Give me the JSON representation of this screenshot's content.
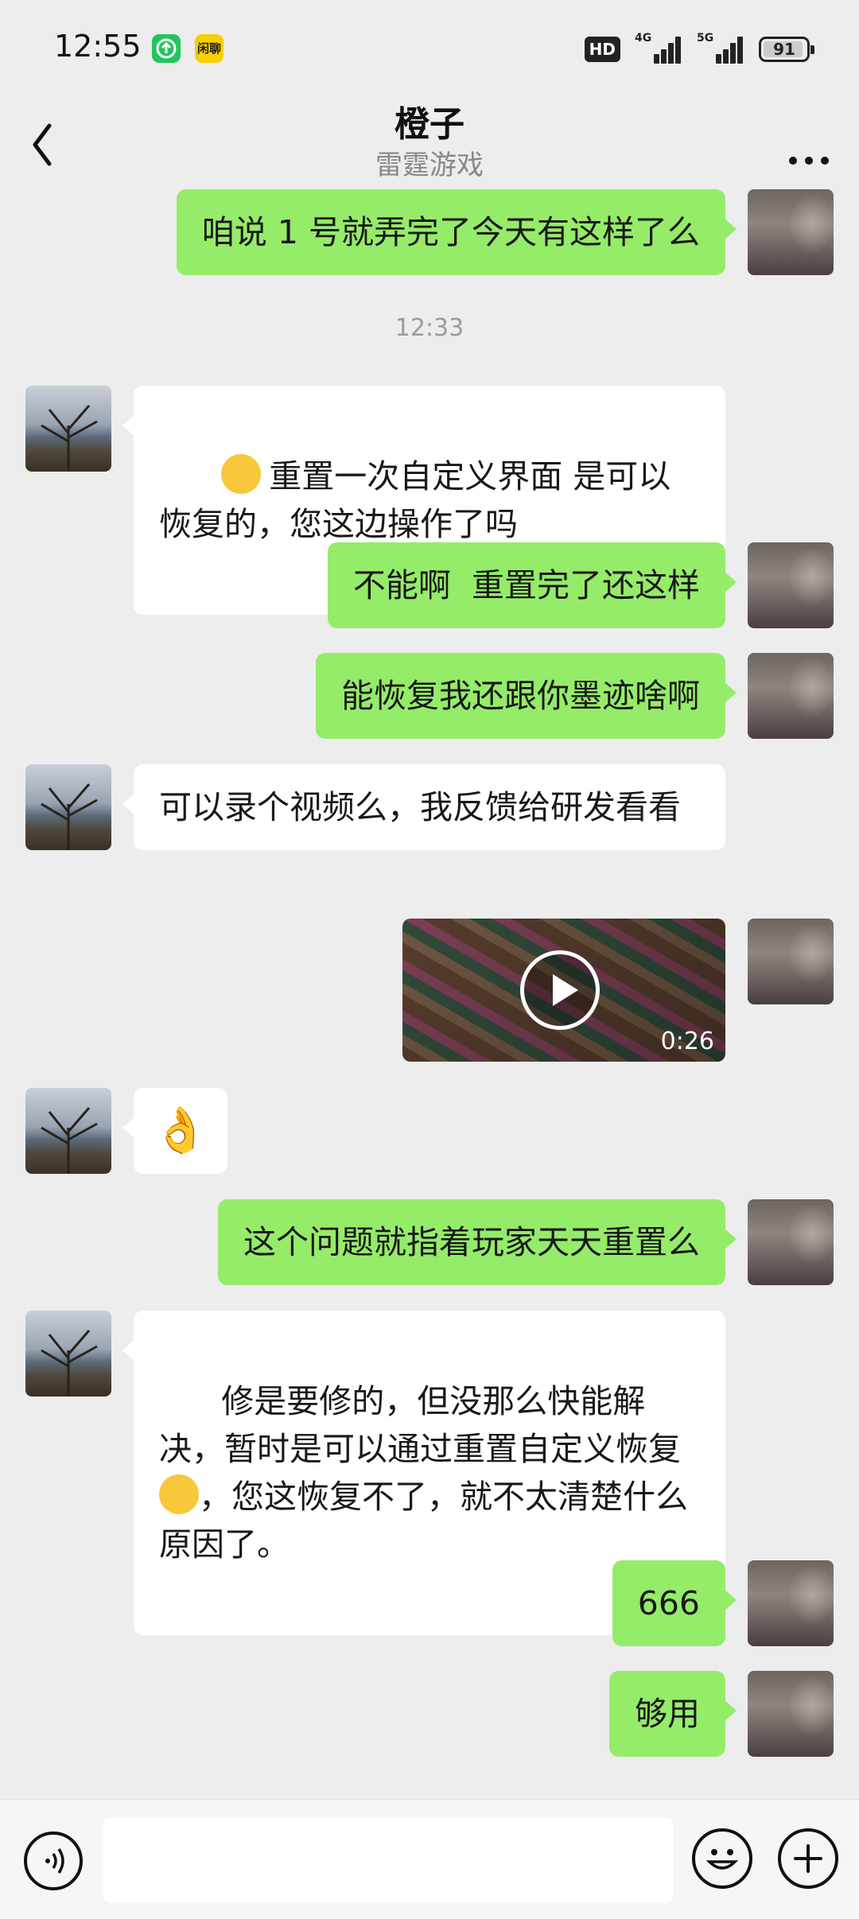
{
  "status_bar": {
    "time": "12:55",
    "app_badge_1_icon": "upload-icon",
    "app_badge_2_text": "闲聊",
    "hd_label": "HD",
    "signal_1_label": "4G",
    "signal_2_label": "5G",
    "battery_level": "91"
  },
  "header": {
    "title": "橙子",
    "subtitle": "雷霆游戏",
    "back_icon": "chevron-left-icon",
    "more_icon": "more-dots-icon"
  },
  "messages": [
    {
      "from": "me",
      "text": "咱说 1 号就弄完了今天有这样了么"
    },
    {
      "type": "time",
      "text": "12:33"
    },
    {
      "from": "other",
      "text": "重置一次自定义界面 是可以恢复的，您这边操作了吗",
      "emoji": "laugh-cry-emoji"
    },
    {
      "from": "me",
      "text": "不能啊  重置完了还这样"
    },
    {
      "from": "me",
      "text": "能恢复我还跟你墨迹啥啊"
    },
    {
      "from": "other",
      "text": "可以录个视频么，我反馈给研发看看"
    },
    {
      "from": "me",
      "type": "video",
      "duration": "0:26"
    },
    {
      "from": "other",
      "type": "emoji",
      "emoji": "ok-hand-emoji"
    },
    {
      "from": "me",
      "text": "这个问题就指着玩家天天重置么"
    },
    {
      "from": "other",
      "text_1": "修是要修的，但没那么快能解决，暂时是可以通过重置自定义恢复",
      "text_2": "，您这恢复不了，就不太清楚什么原因了。",
      "emoji": "laugh-cry-emoji"
    },
    {
      "from": "me",
      "text": "666"
    },
    {
      "from": "me",
      "text": "够用"
    }
  ],
  "bottom_bar": {
    "voice_icon": "voice-icon",
    "input_placeholder": "",
    "emoji_icon": "smiley-icon",
    "plus_icon": "plus-icon"
  },
  "colors": {
    "background": "#ededed",
    "my_bubble": "#95ec69",
    "their_bubble": "#ffffff"
  }
}
